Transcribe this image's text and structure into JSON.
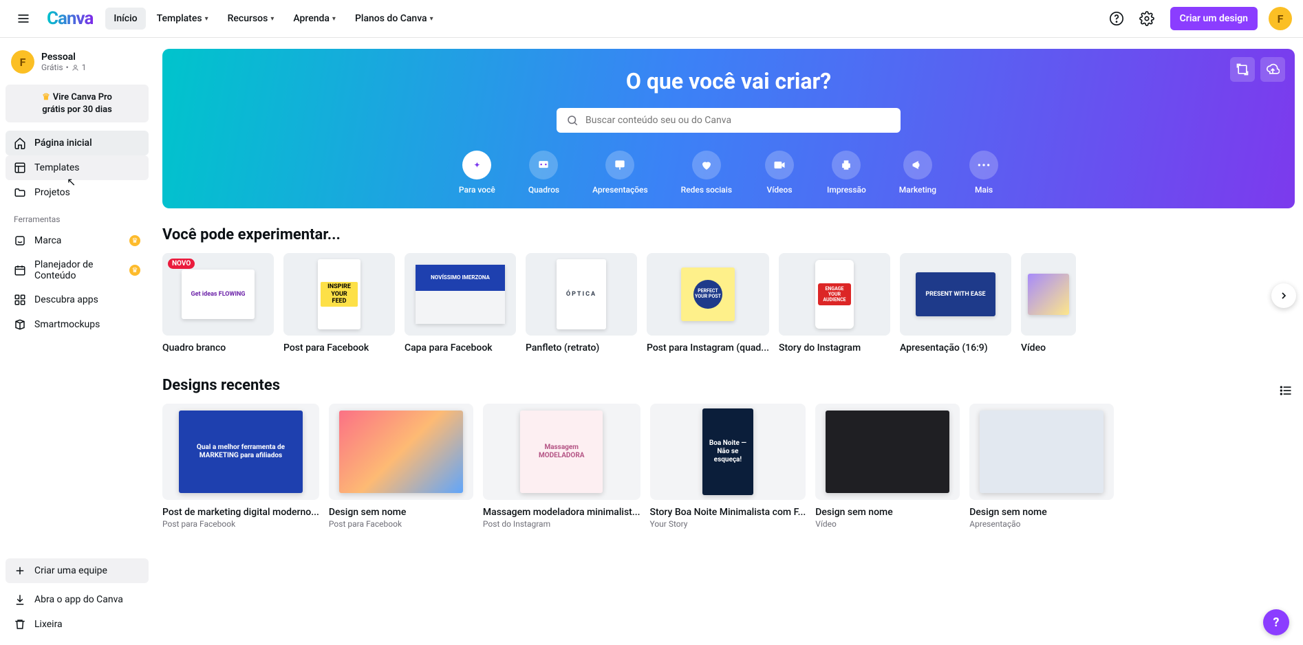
{
  "topbar": {
    "logo": "Canva",
    "nav": {
      "home": "Início",
      "templates": "Templates",
      "resources": "Recursos",
      "learn": "Aprenda",
      "plans": "Planos do Canva"
    },
    "create_button": "Criar um design",
    "avatar_initial": "F"
  },
  "sidebar": {
    "profile": {
      "initial": "F",
      "name": "Pessoal",
      "plan": "Grátis",
      "members": "1"
    },
    "upgrade_line1": "Vire Canva Pro",
    "upgrade_line2": "grátis por 30 dias",
    "nav": {
      "home": "Página inicial",
      "templates": "Templates",
      "projects": "Projetos"
    },
    "tools_title": "Ferramentas",
    "tools": {
      "brand": "Marca",
      "planner": "Planejador de Conteúdo",
      "apps": "Descubra apps",
      "smartmockups": "Smartmockups"
    },
    "bottom": {
      "team": "Criar uma equipe",
      "app": "Abra o app do Canva",
      "trash": "Lixeira"
    }
  },
  "hero": {
    "title": "O que você vai criar?",
    "search_placeholder": "Buscar conteúdo seu ou do Canva",
    "categories": {
      "for_you": "Para você",
      "whiteboards": "Quadros",
      "presentations": "Apresentações",
      "social": "Redes sociais",
      "videos": "Vídeos",
      "print": "Impressão",
      "marketing": "Marketing",
      "more": "Mais"
    }
  },
  "try_section": {
    "title": "Você pode experimentar...",
    "badge_new": "NOVO",
    "items": {
      "whiteboard": "Quadro branco",
      "fb_post": "Post para Facebook",
      "fb_cover": "Capa para Facebook",
      "flyer": "Panfleto (retrato)",
      "ig_post": "Post para Instagram (quad...",
      "ig_story": "Story do Instagram",
      "presentation": "Apresentação (16:9)",
      "video": "Vídeo"
    },
    "thumbs": {
      "whiteboard_text": "Get ideas FLOWING",
      "fb_post_text": "INSPIRE YOUR FEED",
      "fb_cover_text": "NOVÍSSIMO IMERZONA",
      "flyer_text": "ÓPTICA",
      "ig_post_text": "PERFECT YOUR POST",
      "ig_story_text": "ENGAGE YOUR AUDIENCE",
      "presentation_text": "PRESENT WITH EASE"
    }
  },
  "recent_section": {
    "title": "Designs recentes",
    "items": [
      {
        "title": "Post de marketing digital moderno...",
        "subtitle": "Post para Facebook",
        "thumb_text": "Qual a melhor ferramenta de MARKETING para afiliados",
        "kind": "wide",
        "bg": "#1e40af",
        "fg": "#fff"
      },
      {
        "title": "Design sem nome",
        "subtitle": "Post para Facebook",
        "thumb_text": "",
        "kind": "wide",
        "bg": "linear-gradient(135deg,#fb7185,#fdba74,#60a5fa)",
        "fg": "#fff"
      },
      {
        "title": "Massagem modeladora minimalist...",
        "subtitle": "Post do Instagram",
        "thumb_text": "Massagem MODELADORA",
        "kind": "square",
        "bg": "#fdeff2",
        "fg": "#b45384"
      },
      {
        "title": "Story Boa Noite Minimalista com F...",
        "subtitle": "Your Story",
        "thumb_text": "Boa Noite — Não se esqueça!",
        "kind": "story",
        "bg": "#0b1e3a",
        "fg": "#fff"
      },
      {
        "title": "Design sem nome",
        "subtitle": "Vídeo",
        "thumb_text": "",
        "kind": "wide",
        "bg": "#1f1f23",
        "fg": "#fff"
      },
      {
        "title": "Design sem nome",
        "subtitle": "Apresentação",
        "thumb_text": "",
        "kind": "wide",
        "bg": "#e2e8f0",
        "fg": "#334155"
      }
    ]
  },
  "help": "?"
}
